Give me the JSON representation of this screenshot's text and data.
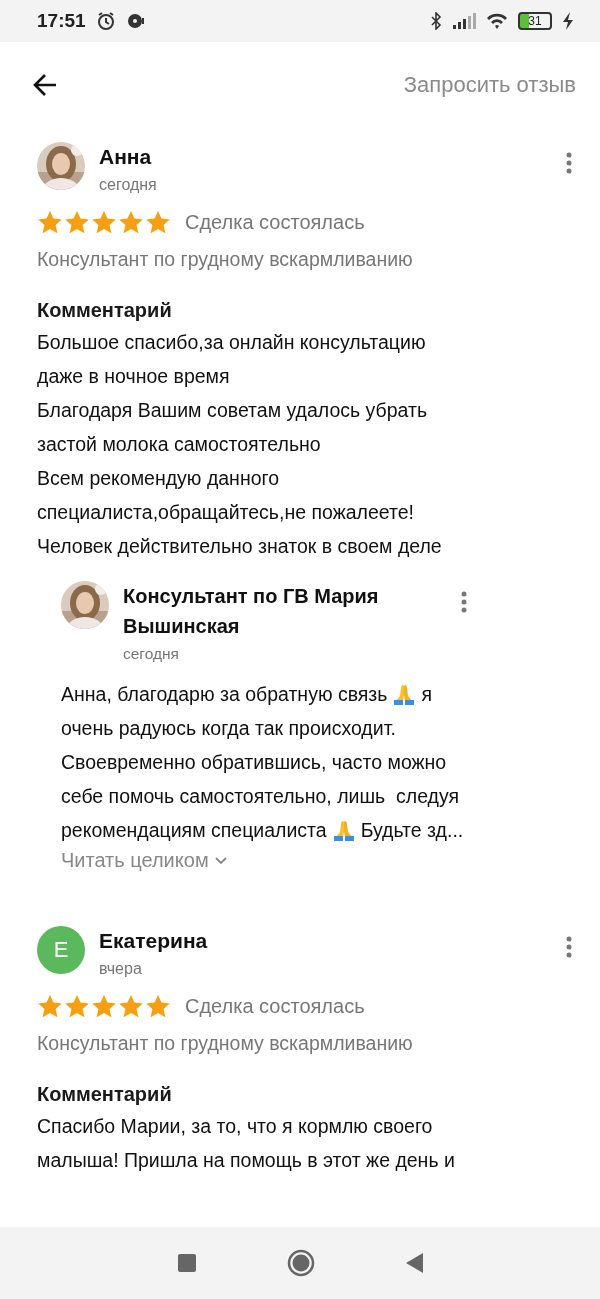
{
  "status_bar": {
    "time": "17:51",
    "battery": "31"
  },
  "header": {
    "action": "Запросить отзыв"
  },
  "reviews": [
    {
      "author": "Анна",
      "date": "сегодня",
      "avatar": {
        "kind": "picture"
      },
      "stars": 5,
      "deal": "Сделка состоялась",
      "category": "Консультант по грудному вскармливанию",
      "comment_title": "Комментарий",
      "comment": [
        "Большое спасибо,за онлайн консультацию",
        "даже в ночное время",
        "Благодаря Вашим советам удалось убрать",
        "застой молока самостоятельно",
        "Всем рекомендую данного",
        "специалиста,обращайтесь,не пожалеете!",
        "Человек действительно знаток в своем деле"
      ],
      "reply": {
        "author": "Консультант по ГВ Мария Вышинская",
        "date": "сегодня",
        "avatar": {
          "kind": "picture"
        },
        "body": [
          [
            {
              "kind": "text",
              "text": "Анна, благодарю за обратную связь"
            },
            {
              "kind": "emoji"
            },
            {
              "kind": "text",
              "text": "я"
            }
          ],
          [
            {
              "kind": "text",
              "text": "очень радуюсь когда так происходит."
            }
          ],
          [
            {
              "kind": "text",
              "text": "Своевременно обратившись, часто можно"
            }
          ],
          [
            {
              "kind": "text",
              "text": "себе помочь самостоятельно, лишь  следуя"
            }
          ],
          [
            {
              "kind": "text",
              "text": "рекомендациям специалиста"
            },
            {
              "kind": "emoji"
            },
            {
              "kind": "text",
              "text": "Будьте зд..."
            }
          ]
        ],
        "read_more": "Читать целиком"
      }
    },
    {
      "author": "Екатерина",
      "date": "вчера",
      "avatar": {
        "kind": "letter",
        "letter": "Е",
        "color": "#5cb85c"
      },
      "stars": 5,
      "deal": "Сделка состоялась",
      "category": "Консультант по грудному вскармливанию",
      "comment_title": "Комментарий",
      "comment": [
        "Спасибо Марии, за то, что я кормлю своего",
        "малыша! Пришла на помощь в этот же день и"
      ]
    }
  ]
}
